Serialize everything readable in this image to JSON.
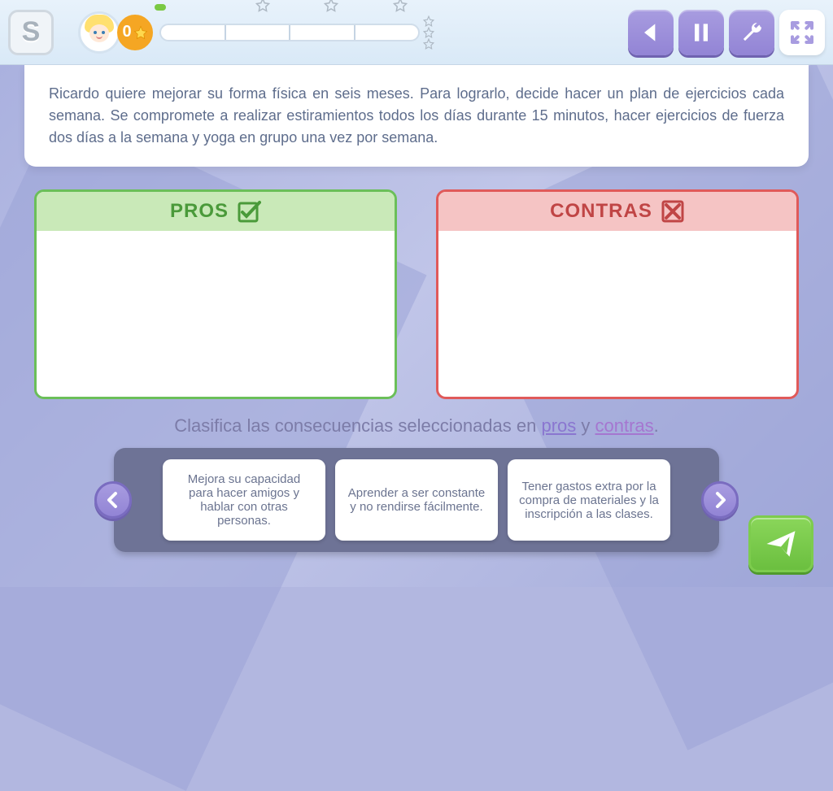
{
  "topbar": {
    "logo_letter": "S",
    "score": "0"
  },
  "scenario": {
    "text": "Ricardo quiere mejorar su forma física en seis meses. Para lograrlo, decide hacer un plan de ejercicios cada semana. Se compromete a realizar estiramientos todos los días durante 15 minutos, hacer ejercicios de fuerza dos días a la semana y yoga en grupo una vez por semana."
  },
  "zones": {
    "pros_label": "PROS",
    "cons_label": "CONTRAS"
  },
  "instruction": {
    "prefix": "Clasifica las consecuencias seleccionadas en ",
    "pros_word": "pros",
    "mid": " y ",
    "cons_word": "contras",
    "suffix": "."
  },
  "cards": [
    "Mejora su capacidad para hacer amigos y hablar con otras personas.",
    "Aprender a ser constante y no rendirse fácilmente.",
    "Tener gastos extra por la compra de materiales y la inscripción a las clases."
  ]
}
